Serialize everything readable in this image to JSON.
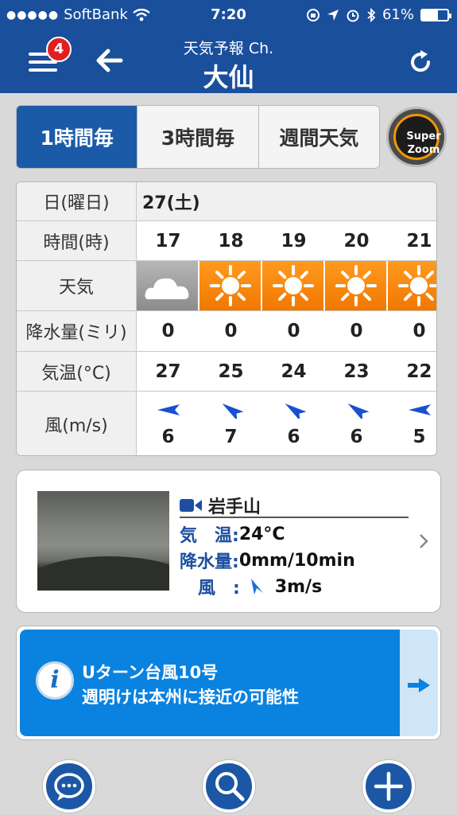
{
  "status_bar": {
    "carrier": "SoftBank",
    "time": "7:20",
    "battery": "61%",
    "battery_level": 0.61
  },
  "header": {
    "badge_count": "4",
    "subtitle": "天気予報 Ch.",
    "title": "大仙"
  },
  "tabs": [
    {
      "label": "1時間毎",
      "active": true
    },
    {
      "label": "3時間毎",
      "active": false
    },
    {
      "label": "週間天気",
      "active": false
    }
  ],
  "zoom": {
    "line1": "Super",
    "line2": "Zoom"
  },
  "forecast": {
    "labels": {
      "date": "日(曜日)",
      "hour": "時間(時)",
      "weather": "天気",
      "precip": "降水量(ミリ)",
      "temp": "気温(°C)",
      "wind": "風(m/s)"
    },
    "date": "27(土)",
    "hours": [
      "17",
      "18",
      "19",
      "20",
      "21"
    ],
    "weather": [
      "cloud-icon",
      "sun-icon",
      "sun-icon",
      "sun-icon",
      "sun-icon"
    ],
    "precip": [
      "0",
      "0",
      "0",
      "0",
      "0"
    ],
    "temp": [
      "27",
      "25",
      "24",
      "23",
      "22"
    ],
    "wind_speed": [
      "6",
      "7",
      "6",
      "6",
      "5"
    ],
    "wind_arrow_angle": [
      180,
      215,
      215,
      215,
      180
    ]
  },
  "camera": {
    "title": "岩手山",
    "temp_label": "気　温:",
    "temp_value": "24°C",
    "precip_label": "降水量:",
    "precip_value": "0mm/10min",
    "wind_label": "風　:",
    "wind_value": "3m/s"
  },
  "news": {
    "line1": "Uターン台風10号",
    "line2": "週明けは本州に接近の可能性"
  },
  "colors": {
    "header_blue": "#1a4f9c",
    "tab_active": "#1b5aa6",
    "sun_orange": "#f58a0c",
    "news_blue": "#0a82e0"
  }
}
